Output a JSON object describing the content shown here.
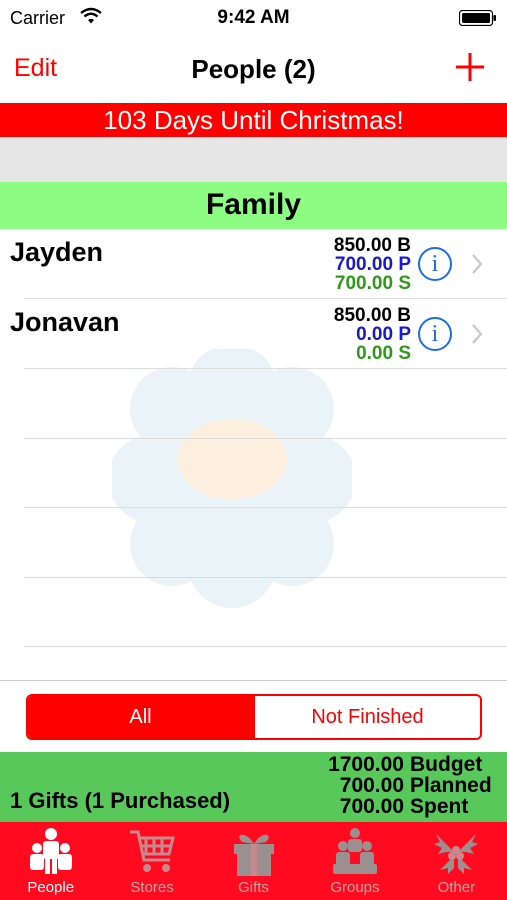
{
  "status_bar": {
    "carrier": "Carrier",
    "time": "9:42 AM"
  },
  "nav": {
    "edit_label": "Edit",
    "title": "People (2)"
  },
  "banner": "103 Days Until Christmas!",
  "section": {
    "title": "Family"
  },
  "people": [
    {
      "name": "Jayden",
      "budget": "850.00 B",
      "planned": "700.00 P",
      "spent": "700.00 S"
    },
    {
      "name": "Jonavan",
      "budget": "850.00 B",
      "planned": "0.00 P",
      "spent": "0.00 S"
    }
  ],
  "info_glyph": "i",
  "segmented": {
    "all_label": "All",
    "not_finished_label": "Not Finished",
    "selected": "All"
  },
  "summary": {
    "gifts": "1 Gifts (1 Purchased)",
    "budget_value": "1700.00",
    "budget_label": "Budget",
    "planned_value": "700.00",
    "planned_label": "Planned",
    "spent_value": "700.00",
    "spent_label": "Spent"
  },
  "tabs": [
    {
      "label": "People",
      "icon": "people-icon",
      "active": true
    },
    {
      "label": "Stores",
      "icon": "cart-icon",
      "active": false
    },
    {
      "label": "Gifts",
      "icon": "gift-icon",
      "active": false
    },
    {
      "label": "Groups",
      "icon": "groups-icon",
      "active": false
    },
    {
      "label": "Other",
      "icon": "holly-icon",
      "active": false
    }
  ],
  "colors": {
    "accent": "#ff0000",
    "section_green": "#8cfc83",
    "summary_green": "#58c85a",
    "planned_blue": "#1a1acc",
    "spent_green": "#2e9a18",
    "tab_bar": "#ff0a1e"
  }
}
